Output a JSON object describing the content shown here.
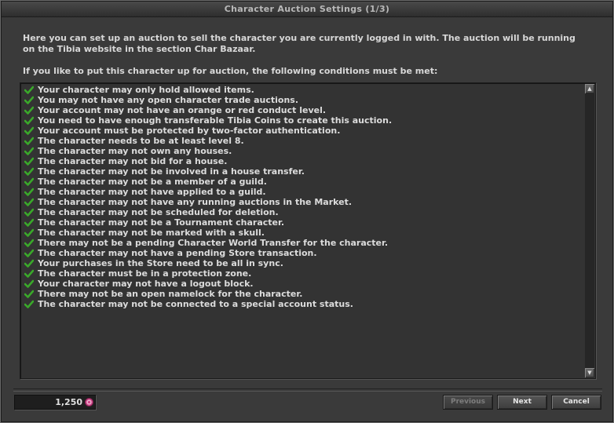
{
  "window": {
    "title": "Character Auction Settings (1/3)"
  },
  "intro": {
    "paragraph1": "Here you can set up an auction to sell the character you are currently logged in with. The auction will be running on the Tibia website in the section Char Bazaar.",
    "paragraph2": "If you like to put this character up for auction, the following conditions must be met:"
  },
  "conditions": [
    "Your character may only hold allowed items.",
    "You may not have any open character trade auctions.",
    "Your account may not have an orange or red conduct level.",
    "You need to have enough transferable Tibia Coins to create this auction.",
    "Your account must be protected by two-factor authentication.",
    "The character needs to be at least level 8.",
    "The character may not own any houses.",
    "The character may not bid for a house.",
    "The character may not be involved in a house transfer.",
    "The character may not be a member of a guild.",
    "The character may not have applied to a guild.",
    "The character may not have any running auctions in the Market.",
    "The character may not be scheduled for deletion.",
    "The character may not be a Tournament character.",
    "The character may not be marked with a skull.",
    "There may not be a pending Character World Transfer for the character.",
    "The character may not have a pending Store transaction.",
    "Your purchases in the Store need to be all in sync.",
    "The character must be in a protection zone.",
    "Your character may not have a logout block.",
    "There may not be an open namelock for the character.",
    "The character may not be connected to a special account status."
  ],
  "coins": {
    "value": "1,250",
    "icon": "tibia-coin-icon"
  },
  "buttons": {
    "previous": "Previous",
    "next": "Next",
    "cancel": "Cancel"
  },
  "colors": {
    "check": "#3aa82a",
    "coin": "#d04a8a"
  }
}
